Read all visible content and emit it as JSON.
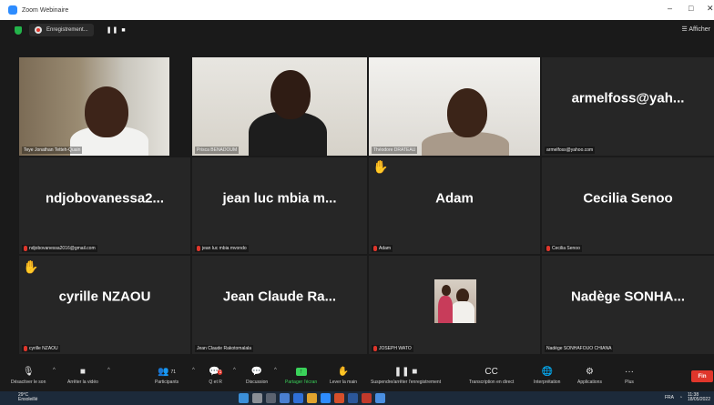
{
  "window": {
    "title": "Zoom Webinaire",
    "minimize": "–",
    "maximize": "□",
    "close": "✕"
  },
  "recording": {
    "label": "Enregistrement...",
    "controls": "❚❚ ■"
  },
  "view_button": "☰ Afficher",
  "tiles": [
    {
      "id": "teye",
      "type": "video",
      "name": "Teye Jonathan Tetteh-Quain",
      "muted": false
    },
    {
      "id": "priscille",
      "type": "video",
      "name": "Prisca BENADOUM",
      "muted": false,
      "active": true
    },
    {
      "id": "theodore",
      "type": "video",
      "name": "Théodore DRATEAU",
      "muted": false
    },
    {
      "id": "armel",
      "type": "name",
      "display": "armelfoss@yah...",
      "name": "armelfoss@yahoo.com",
      "muted": false
    },
    {
      "id": "ndjobo",
      "type": "name",
      "display": "ndjobovanessa2...",
      "name": "ndjobovanessa2016@gmail.com",
      "muted": true
    },
    {
      "id": "jeanluc",
      "type": "name",
      "display": "jean luc mbia m...",
      "name": "jean luc mbia mvondo",
      "muted": true
    },
    {
      "id": "adam",
      "type": "name",
      "display": "Adam",
      "name": "Adam",
      "muted": true,
      "hand": true
    },
    {
      "id": "cecilia",
      "type": "name",
      "display": "Cecilia Senoo",
      "name": "Cecilia Senoo",
      "muted": true
    },
    {
      "id": "cyrille",
      "type": "name",
      "display": "cyrille NZAOU",
      "name": "cyrille NZAOU",
      "muted": true,
      "hand": true
    },
    {
      "id": "jeanclaude",
      "type": "name",
      "display": "Jean Claude Ra...",
      "name": "Jean Claude Rakotomalala",
      "muted": false
    },
    {
      "id": "joseph",
      "type": "thumb",
      "name": "JOSEPH WATO",
      "muted": true
    },
    {
      "id": "nadege",
      "type": "name",
      "display": "Nadège SONHA...",
      "name": "Nadège SONHAFOUO CHIANA",
      "muted": false
    }
  ],
  "toolbar": {
    "mute": "Désactiver le son",
    "video": "Arrêter la vidéo",
    "participants": "Participants",
    "participants_count": "71",
    "qa": "Q et R",
    "qa_badge": "1",
    "chat": "Discussion",
    "share": "Partager l'écran",
    "raise_hand": "Lever la main",
    "recording": "Suspendre/arrêter l'enregistrement",
    "transcript": "Transcription en direct",
    "interpretation": "Interprétation",
    "apps": "Applications",
    "more": "Plus",
    "end": "Fin"
  },
  "taskbar": {
    "temp": "29°C",
    "weather": "Ensoleillé",
    "lang": "FRA",
    "time": "11:38",
    "date": "18/05/2022"
  }
}
